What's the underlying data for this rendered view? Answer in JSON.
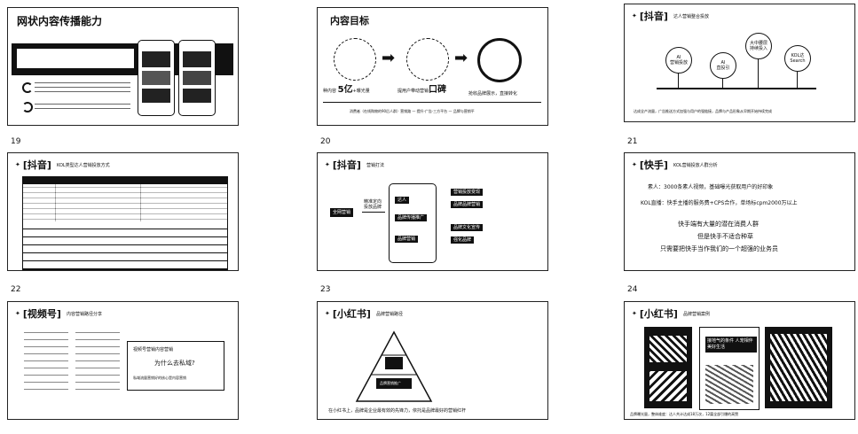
{
  "page_numbers": [
    "19",
    "20",
    "21",
    "22",
    "23",
    "24"
  ],
  "brand_mark": "✦",
  "slide1": {
    "title": "网状内容传播能力"
  },
  "slide2": {
    "title": "内容目标",
    "bottom_left_prefix": "种内容",
    "big_number": "5亿",
    "bottom_left_suffix": "+曝光量",
    "bottom_mid": "提用户带动营销",
    "bottom_mid_bold": "口碑",
    "bottom_right": "抢收品牌展示，直接转化",
    "footer": "消费者（在线购物的90后人群）营销路 — 提升·广告·三方平台 — 品牌与营销平"
  },
  "slide3": {
    "tag": "[抖音]",
    "subtitle": "达人营销整合投放",
    "nodes": [
      {
        "line1": "AI",
        "line2": "营销投放"
      },
      {
        "line1": "AI",
        "line2": "直投引"
      },
      {
        "line1": "大中腰层",
        "line2": "持续投入"
      },
      {
        "line1": "KOL达",
        "line2": "Search"
      }
    ],
    "footer": "达成全产流量，广告推送方式加强与用户的强链接，品牌与产品形象从早期开始持续完成"
  },
  "slide4": {
    "tag": "[抖音]",
    "subtitle": "KOL类型达人营销投放方式"
  },
  "slide5": {
    "tag": "[抖音]",
    "subtitle": "营销打法",
    "left_box": "全网营销",
    "arrow_label_1": "精准定向",
    "arrow_label_2": "投放品牌",
    "mid_items": [
      "达人",
      "品牌传播推广",
      "品牌营销"
    ],
    "right_items": [
      "营销投放变现",
      "品牌品牌营销",
      "品牌文化宣传",
      "强化品牌"
    ]
  },
  "slide6": {
    "tag": "[快手]",
    "subtitle": "KOL营销投放人群分析",
    "line1": "素人：3000条素人视频，基础曝光获取用户的好印象",
    "line2": "KOL直播：快手主播的服务费+CPS合作，单场标cpm2000万以上",
    "line3": "快手端有大量的潜在消费人群",
    "line4": "但是快手不适合种草",
    "line5": "只需要把快手当作我们的一个超强的业务员"
  },
  "slide7": {
    "tag": "[视频号]",
    "subtitle": "内容营销路径分享",
    "box_line1": "视频号营销内容营销",
    "box_line2": "为什么去私域?",
    "box_line3": "私域流量营销好的核心是内容营销"
  },
  "slide8": {
    "tag": "[小红书]",
    "subtitle": "品牌营销路径",
    "pyramid_top": "",
    "pyramid_label": "品牌营销推广",
    "footer": "在小红书上，品牌是企业最有效的先锋力，依托是品牌最好的营销红杆"
  },
  "slide9": {
    "tag": "[小红书]",
    "subtitle": "品牌营销案例",
    "card_text": "接地气的条件 人宠相伴美好生活",
    "footer": "品牌曝光量，整体维度：达人共计达成18万次，12篇全部引爆的高赞"
  }
}
